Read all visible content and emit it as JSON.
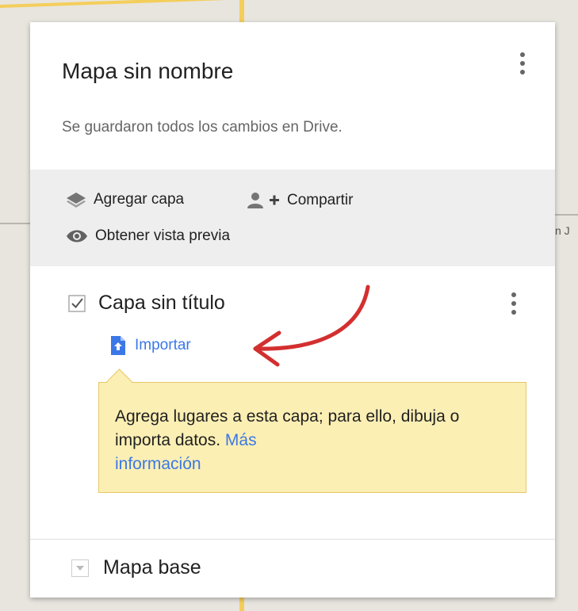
{
  "map": {
    "label_fragment": "n J"
  },
  "panel": {
    "title": "Mapa sin nombre",
    "status": "Se guardaron todos los cambios en Drive.",
    "actions": {
      "add_layer": "Agregar capa",
      "share": "Compartir",
      "preview": "Obtener vista previa"
    },
    "layer": {
      "title": "Capa sin título",
      "checked": true,
      "import_label": "Importar"
    },
    "tooltip": {
      "text": "Agrega lugares a esta capa; para ello, dibuja o importa datos. ",
      "link_line1": "Más",
      "link_line2": "información"
    },
    "base_map": {
      "label": "Mapa base"
    }
  },
  "colors": {
    "accent": "#3b78e7",
    "annotation_arrow": "#d32f2f",
    "tooltip_bg": "#fcefb4"
  }
}
